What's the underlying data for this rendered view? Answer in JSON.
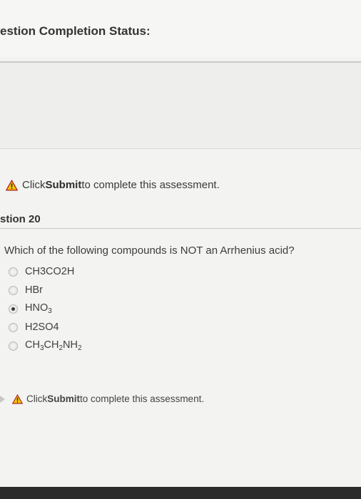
{
  "header": {
    "title": "estion Completion Status:"
  },
  "top_notice": {
    "prefix": "Click ",
    "bold": "Submit",
    "suffix": " to complete this assessment."
  },
  "question": {
    "label": "stion 20",
    "text": "Which of the following compounds is NOT an Arrhenius acid?",
    "options": [
      {
        "parts": [
          "CH3CO2H"
        ],
        "selected": false
      },
      {
        "parts": [
          "HBr"
        ],
        "selected": false
      },
      {
        "parts": [
          "HNO",
          "3"
        ],
        "selected": true
      },
      {
        "parts": [
          "H2SO4"
        ],
        "selected": false
      },
      {
        "parts": [
          "CH",
          "3",
          "CH",
          "2",
          "NH",
          "2"
        ],
        "selected": false
      }
    ]
  },
  "bottom_notice": {
    "prefix": "Click ",
    "bold": "Submit",
    "suffix": " to complete this assessment."
  },
  "icons": {
    "warning": "warning-triangle-icon",
    "arrow": "arrow-right-icon"
  },
  "colors": {
    "warning_fill": "#f5c300",
    "warning_stroke": "#b02a2a"
  }
}
